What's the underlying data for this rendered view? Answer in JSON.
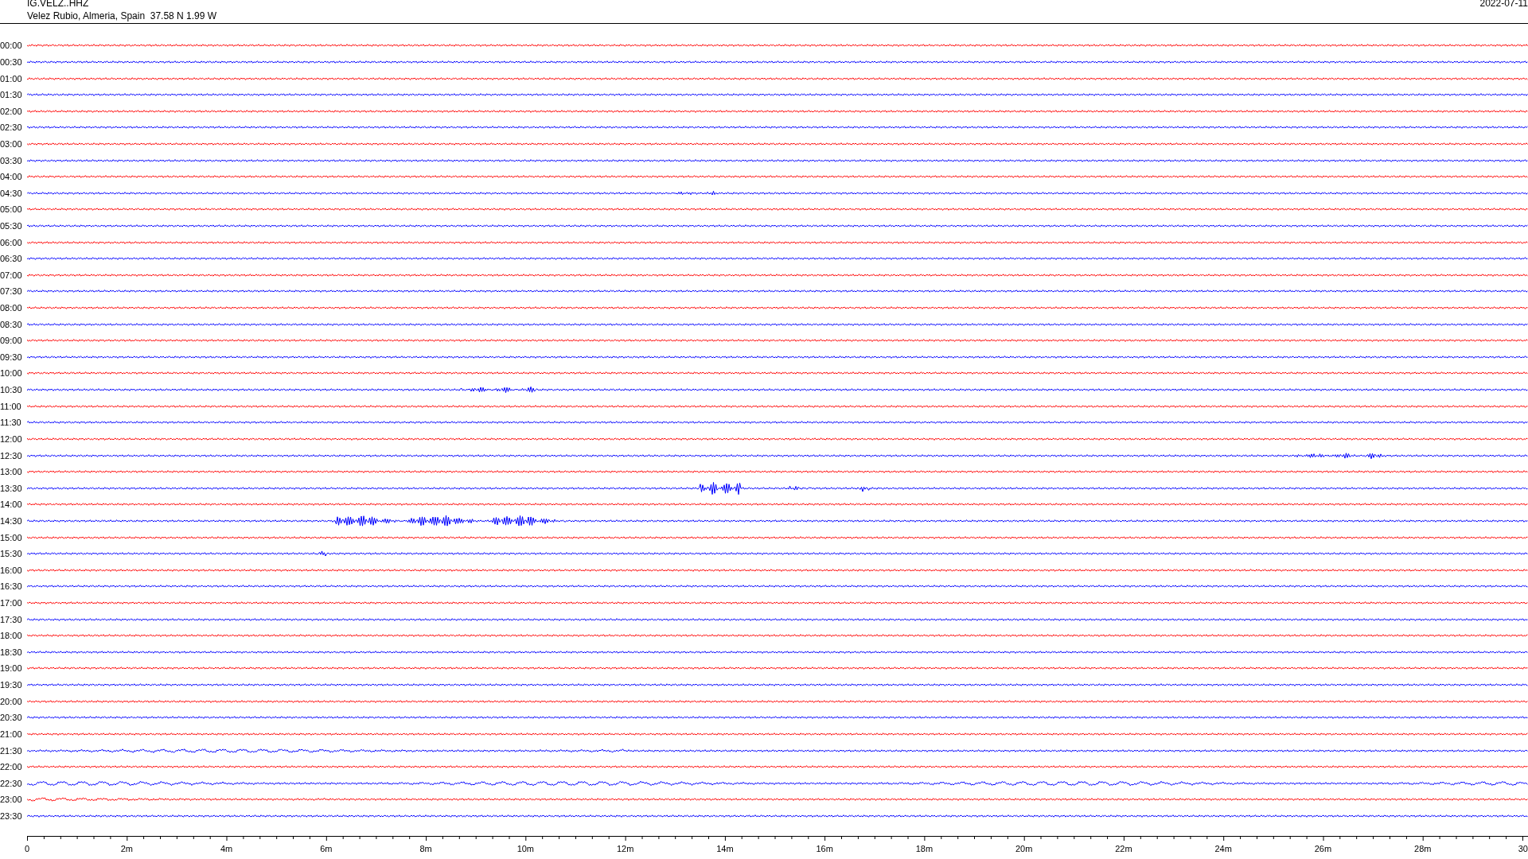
{
  "header": {
    "station": "IG.VELZ..HHZ",
    "location": "Velez Rubio, Almeria, Spain  37.58 N 1.99 W",
    "date": "2022-07-11"
  },
  "rows": [
    {
      "time": "00:00",
      "color": "#ff0000"
    },
    {
      "time": "00:30",
      "color": "#0000ff"
    },
    {
      "time": "01:00",
      "color": "#ff0000"
    },
    {
      "time": "01:30",
      "color": "#0000ff"
    },
    {
      "time": "02:00",
      "color": "#ff0000"
    },
    {
      "time": "02:30",
      "color": "#0000ff"
    },
    {
      "time": "03:00",
      "color": "#ff0000"
    },
    {
      "time": "03:30",
      "color": "#0000ff"
    },
    {
      "time": "04:00",
      "color": "#ff0000"
    },
    {
      "time": "04:30",
      "color": "#0000ff"
    },
    {
      "time": "05:00",
      "color": "#ff0000"
    },
    {
      "time": "05:30",
      "color": "#0000ff"
    },
    {
      "time": "06:00",
      "color": "#ff0000"
    },
    {
      "time": "06:30",
      "color": "#0000ff"
    },
    {
      "time": "07:00",
      "color": "#ff0000"
    },
    {
      "time": "07:30",
      "color": "#0000ff"
    },
    {
      "time": "08:00",
      "color": "#ff0000"
    },
    {
      "time": "08:30",
      "color": "#0000ff"
    },
    {
      "time": "09:00",
      "color": "#ff0000"
    },
    {
      "time": "09:30",
      "color": "#0000ff"
    },
    {
      "time": "10:00",
      "color": "#ff0000"
    },
    {
      "time": "10:30",
      "color": "#0000ff"
    },
    {
      "time": "11:00",
      "color": "#ff0000"
    },
    {
      "time": "11:30",
      "color": "#0000ff"
    },
    {
      "time": "12:00",
      "color": "#ff0000"
    },
    {
      "time": "12:30",
      "color": "#0000ff"
    },
    {
      "time": "13:00",
      "color": "#ff0000"
    },
    {
      "time": "13:30",
      "color": "#0000ff"
    },
    {
      "time": "14:00",
      "color": "#ff0000"
    },
    {
      "time": "14:30",
      "color": "#0000ff"
    },
    {
      "time": "15:00",
      "color": "#ff0000"
    },
    {
      "time": "15:30",
      "color": "#0000ff"
    },
    {
      "time": "16:00",
      "color": "#ff0000"
    },
    {
      "time": "16:30",
      "color": "#0000ff"
    },
    {
      "time": "17:00",
      "color": "#ff0000"
    },
    {
      "time": "17:30",
      "color": "#0000ff"
    },
    {
      "time": "18:00",
      "color": "#ff0000"
    },
    {
      "time": "18:30",
      "color": "#0000ff"
    },
    {
      "time": "19:00",
      "color": "#ff0000"
    },
    {
      "time": "19:30",
      "color": "#0000ff"
    },
    {
      "time": "20:00",
      "color": "#ff0000"
    },
    {
      "time": "20:30",
      "color": "#0000ff"
    },
    {
      "time": "21:00",
      "color": "#ff0000"
    },
    {
      "time": "21:30",
      "color": "#0000ff"
    },
    {
      "time": "22:00",
      "color": "#ff0000"
    },
    {
      "time": "22:30",
      "color": "#0000ff"
    },
    {
      "time": "23:00",
      "color": "#ff0000"
    },
    {
      "time": "23:30",
      "color": "#0000ff"
    }
  ],
  "x_axis": {
    "labels": [
      "0",
      "2m",
      "4m",
      "6m",
      "8m",
      "10m",
      "12m",
      "14m",
      "16m",
      "18m",
      "20m",
      "22m",
      "24m",
      "26m",
      "28m",
      "30"
    ]
  }
}
